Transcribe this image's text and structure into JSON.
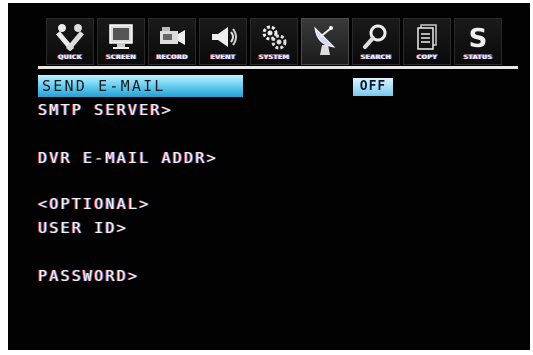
{
  "toolbar": {
    "items": [
      {
        "label": "QUICK",
        "icon": "tools-icon"
      },
      {
        "label": "SCREEN",
        "icon": "monitor-icon"
      },
      {
        "label": "RECORD",
        "icon": "camera-icon"
      },
      {
        "label": "EVENT",
        "icon": "megaphone-icon"
      },
      {
        "label": "SYSTEM",
        "icon": "gears-icon"
      },
      {
        "label": "",
        "icon": "satellite-dish-icon"
      },
      {
        "label": "SEARCH",
        "icon": "magnifier-icon"
      },
      {
        "label": "COPY",
        "icon": "documents-icon"
      },
      {
        "label": "STATUS",
        "icon": "status-s-icon"
      }
    ],
    "active_index": 5
  },
  "menu": {
    "send_email": "SEND E-MAIL",
    "smtp_server": "SMTP SERVER>",
    "dvr_email_addr": "DVR E-MAIL ADDR>",
    "optional": "<OPTIONAL>",
    "user_id": "USER ID>",
    "password": "PASSWORD>"
  },
  "send_email_value": "OFF",
  "colors": {
    "background": "#020202",
    "highlight": "#5ec9ef",
    "text": "#f2f2f2"
  }
}
